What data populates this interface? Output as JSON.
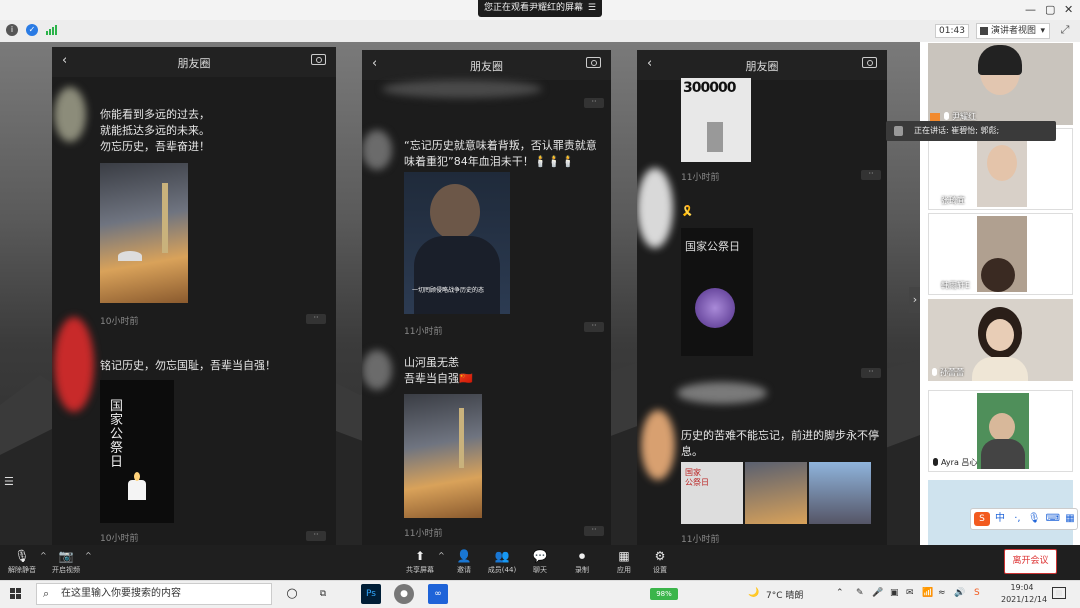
{
  "banner": {
    "text": "您正在观看尹耀红的屏幕",
    "icon": "menu-icon"
  },
  "window": {
    "minimize": "—",
    "restore": "▢",
    "close": "✕"
  },
  "infobar": {
    "timer": "01:43",
    "view_label": "演讲者视图",
    "view_caret": "▾"
  },
  "phones": [
    {
      "title": "朋友圈",
      "posts": [
        {
          "text": "你能看到多远的过去，\n就能抵达多远的未来。\n勿忘历史，吾辈奋进！",
          "time": "10小时前"
        },
        {
          "text": "铭记历史，勿忘国耻，吾辈当自强！",
          "image_text": "国\n家\n公\n祭\n日",
          "time": "10小时前"
        }
      ]
    },
    {
      "title": "朋友圈",
      "posts": [
        {
          "text": "“忘记历史就意味着背叛，否认罪责就意味着重犯”84年血泪未干！🕯️🕯️🕯️",
          "image_caption": "一切罔顾侵略战争历史的态",
          "time": "11小时前"
        },
        {
          "text": "山河虽无恙\n吾辈当自强🇨🇳",
          "time": "11小时前"
        }
      ]
    },
    {
      "title": "朋友圈",
      "posts": [
        {
          "image_text": "300000",
          "time": "11小时前"
        },
        {
          "image_text": "国家公祭日",
          "ribbon": "🎗️"
        },
        {
          "text": "历史的苦难不能忘记，前进的脚步永不停息。",
          "thumb_text": "国家\n公祭日",
          "time": "11小时前"
        }
      ]
    }
  ],
  "side_arrow": "›",
  "participants": [
    {
      "name": "尹耀红"
    },
    {
      "name": "张琦宜"
    },
    {
      "name": "韩雨轩E"
    },
    {
      "name": "孙蕾蕾"
    },
    {
      "name": "Ayra 吕心"
    }
  ],
  "speaking": "正在讲话: 崔碧怡; 郭彪;",
  "toolbar": {
    "mute": "解除静音",
    "video": "开启视频",
    "share": "共享屏幕",
    "invite": "邀请",
    "members": "成员(44)",
    "chat": "聊天",
    "record": "录制",
    "apps": "应用",
    "settings": "设置",
    "leave": "离开会议"
  },
  "ime": {
    "label": "中"
  },
  "taskbar": {
    "search_placeholder": "在这里输入你要搜索的内容",
    "battery": "98%",
    "weather": "7°C 晴朗",
    "time": "19:04",
    "date": "2021/12/14"
  },
  "colors": {
    "accent": "#1e63d8",
    "leave": "#d33333"
  }
}
